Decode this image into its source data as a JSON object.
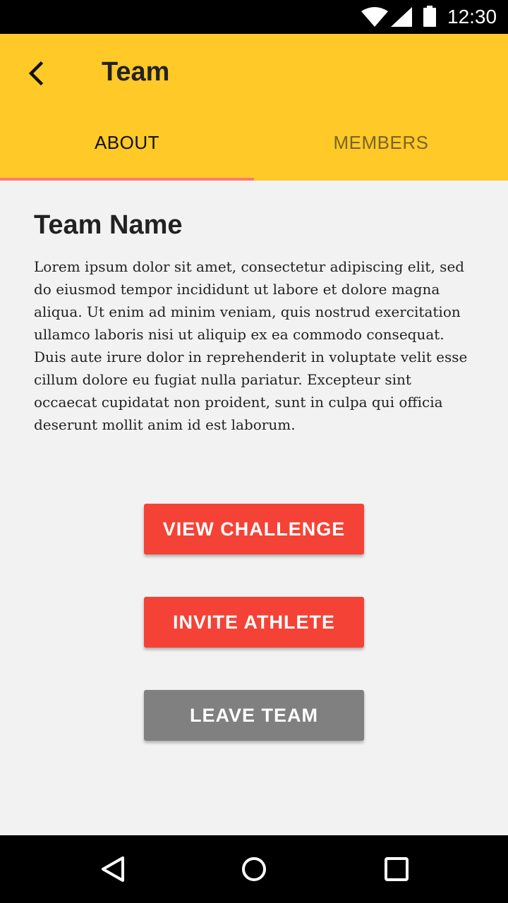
{
  "status_bar": {
    "time": "12:30",
    "icons": [
      "wifi-icon",
      "signal-icon",
      "battery-icon"
    ]
  },
  "app_bar": {
    "title": "Team",
    "back_icon": "chevron-left-icon",
    "color": "#ffc928"
  },
  "tabs": [
    {
      "label": "ABOUT",
      "selected": true
    },
    {
      "label": "MEMBERS",
      "selected": false
    }
  ],
  "main": {
    "team_name": "Team Name",
    "description": "Lorem ipsum dolor sit amet, consectetur adipiscing elit, sed do eiusmod tempor incididunt ut labore et dolore magna aliqua. Ut enim ad minim veniam, quis nostrud exercitation ullamco laboris nisi ut aliquip ex ea commodo consequat. Duis aute irure dolor in reprehenderit in voluptate velit esse cillum dolore eu fugiat nulla pariatur. Excepteur sint occaecat cupidatat non proident, sunt in culpa qui officia deserunt mollit anim id est laborum."
  },
  "actions": {
    "view_challenge": "VIEW CHALLENGE",
    "invite_athlete": "INVITE ATHLETE",
    "leave_team": "LEAVE TEAM",
    "primary_color": "#f44336",
    "secondary_color": "#808080"
  },
  "nav_bar": {
    "icons": [
      "nav-back-icon",
      "nav-home-icon",
      "nav-recents-icon"
    ]
  }
}
